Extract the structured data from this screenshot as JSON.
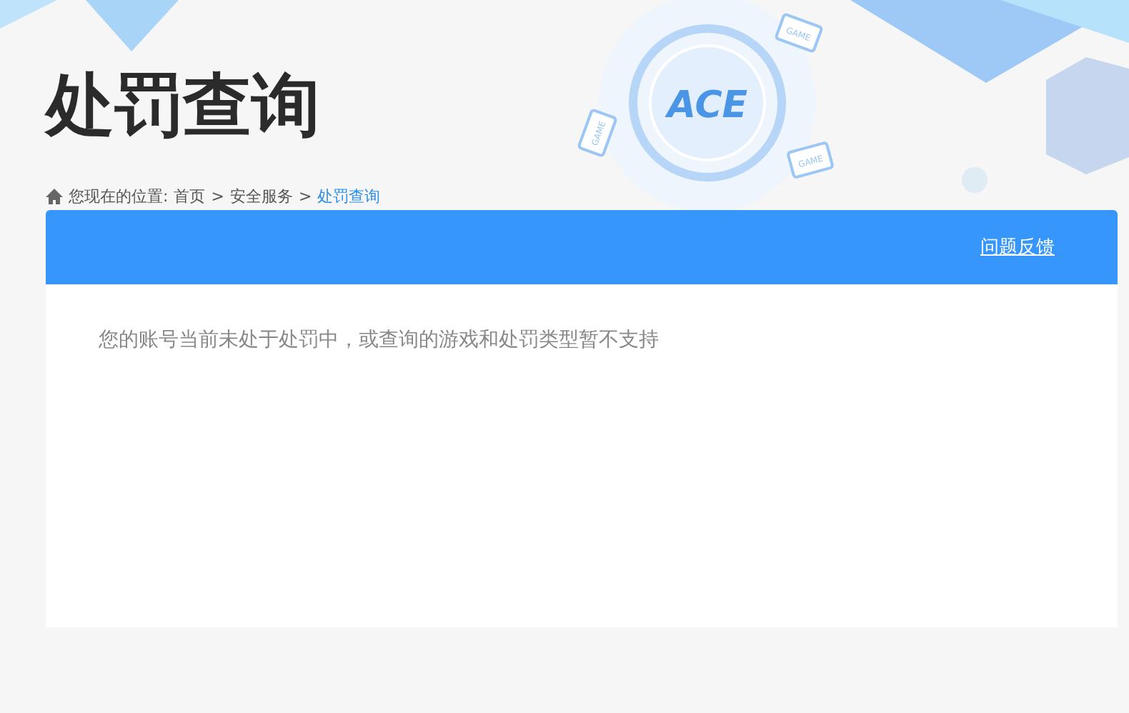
{
  "header": {
    "title": "处罚查询",
    "logo": "ACE",
    "device_labels": [
      "GAME",
      "GAME",
      "GAME"
    ]
  },
  "breadcrumb": {
    "label": "您现在的位置:",
    "separator": ">",
    "items": [
      {
        "text": "首页",
        "current": false
      },
      {
        "text": "安全服务",
        "current": false
      },
      {
        "text": "处罚查询",
        "current": true
      }
    ]
  },
  "panel": {
    "feedback_link": "问题反馈",
    "message": "您的账号当前未处于处罚中，或查询的游戏和处罚类型暂不支持"
  }
}
